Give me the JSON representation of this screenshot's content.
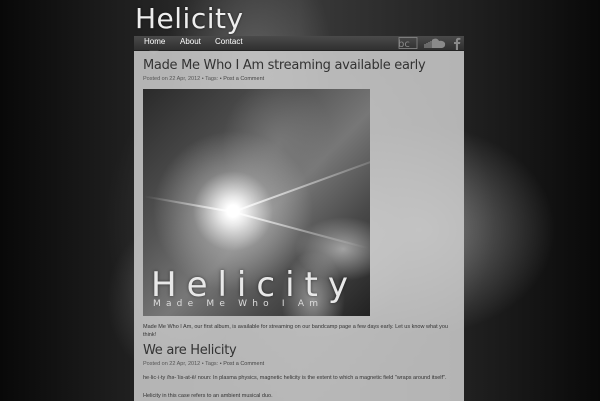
{
  "site": {
    "title": "Helicity"
  },
  "nav": {
    "items": [
      {
        "label": "Home"
      },
      {
        "label": "About"
      },
      {
        "label": "Contact"
      }
    ]
  },
  "social": {
    "bandcamp_icon": "bandcamp-icon",
    "soundcloud_icon": "soundcloud-icon",
    "facebook_icon": "facebook-icon"
  },
  "posts": [
    {
      "title": "Made Me Who I Am streaming available early",
      "posted_prefix": "Posted on 22 Apr, 2012 • Tags:",
      "comment_link": "• Post a Comment",
      "image": {
        "title_text": "Helicity",
        "subtitle_text": "Made Me Who I Am"
      },
      "body": "Made Me Who I Am, our first album, is available for streaming on our bandcamp page a few days early. Let us know what you think!"
    },
    {
      "title": "We are Helicity",
      "posted_prefix": "Posted on 22 Apr, 2012 • Tags:",
      "comment_link": "• Post a Comment",
      "body": "he·lic·i·ty /hə-ˈlis-at-ē/ noun: In plasma physics, magnetic helicity is the extent to which a magnetic field \"wraps around itself\".",
      "body2": "Helicity in this case refers to an ambient musical duo."
    }
  ],
  "colors": {
    "panel": "#cdcdcd",
    "navbar": "#3c3c3c"
  }
}
